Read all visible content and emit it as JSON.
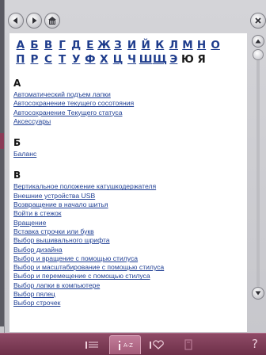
{
  "alphabet": {
    "row1": [
      "А",
      "Б",
      "В",
      "Г",
      "Д",
      "Е",
      "Ж",
      "З",
      "И",
      "Й",
      "К",
      "Л",
      "М",
      "Н",
      "О"
    ],
    "row2": [
      "П",
      "Р",
      "С",
      "Т",
      "У",
      "Ф",
      "Х",
      "Ц",
      "Ч",
      "Ш",
      "Щ",
      "Э",
      "Ю",
      "Я"
    ]
  },
  "sections": [
    {
      "letter": "А",
      "items": [
        "Автоматический подъем лапки",
        "Автосохранение текущего сосотояния",
        "Автосохранение Текущего статуса",
        "Аксессуары"
      ]
    },
    {
      "letter": "Б",
      "items": [
        "Баланс"
      ]
    },
    {
      "letter": "В",
      "items": [
        "Вертикальное положение катушкодержателя",
        "Внешние устройства USB",
        "Возвращение в начало шитья",
        "Войти в стежок",
        "Вращение",
        "Вставка строчки или букв",
        "Выбор вышивального шрифта",
        "Выбор дизайна",
        "Выбор и вращение с помощью стилуса",
        "Выбор и масштабирование с помощью стилуса",
        "Выбор и перемещение с помощью стилуса",
        "Выбор лапки в компьютере",
        "Выбор пялец",
        "Выбор строчек"
      ]
    }
  ],
  "bottom_tabs": [
    {
      "name": "contents",
      "label": ""
    },
    {
      "name": "a-z-index",
      "label": "A-Z"
    },
    {
      "name": "favorites",
      "label": ""
    },
    {
      "name": "book",
      "label": ""
    }
  ],
  "help_glyph": "?"
}
